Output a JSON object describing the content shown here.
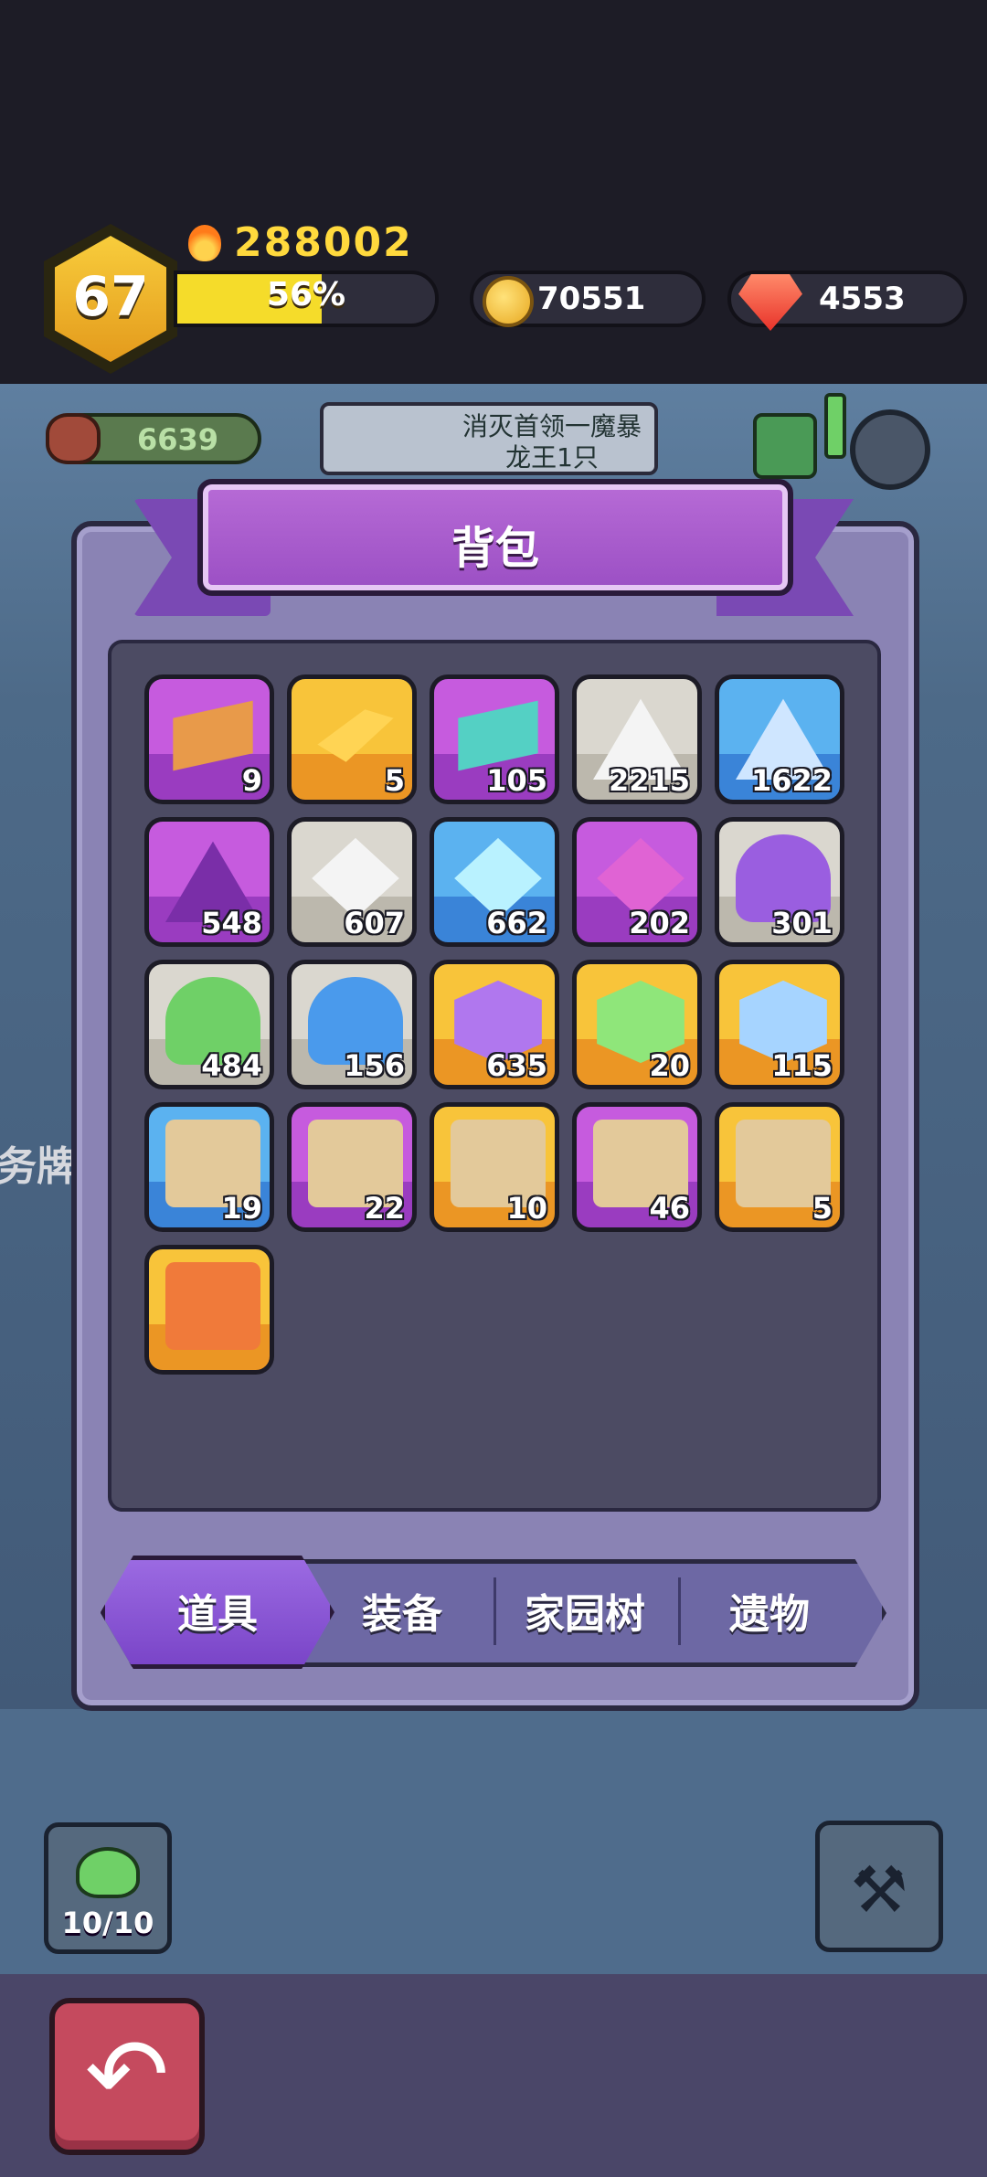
{
  "header": {
    "level": "67",
    "power": "288002",
    "xp_percent_label": "56%",
    "xp_fraction": 0.56,
    "coins": "70551",
    "gems": "4553"
  },
  "scene": {
    "meat": "6639",
    "quest_text": "消灭首领一魔暴龙王1只",
    "side_text": "务牌",
    "slime_count": "10/10"
  },
  "panel": {
    "title": "背包",
    "items": [
      {
        "icon": "purple-ticket-icon",
        "count": "9"
      },
      {
        "icon": "gold-bar-icon",
        "count": "5"
      },
      {
        "icon": "teal-ticket-icon",
        "count": "105"
      },
      {
        "icon": "grey-ore-icon",
        "count": "2215"
      },
      {
        "icon": "blue-ore-icon",
        "count": "1622"
      },
      {
        "icon": "purple-ore-icon",
        "count": "548"
      },
      {
        "icon": "grey-crystal-icon",
        "count": "607"
      },
      {
        "icon": "blue-crystal-icon",
        "count": "662"
      },
      {
        "icon": "purple-crystal-icon",
        "count": "202"
      },
      {
        "icon": "purple-slime-icon",
        "count": "301"
      },
      {
        "icon": "green-slime-icon",
        "count": "484"
      },
      {
        "icon": "blue-slime-icon",
        "count": "156"
      },
      {
        "icon": "purple-cube-icon",
        "count": "635"
      },
      {
        "icon": "green-cube-icon",
        "count": "20"
      },
      {
        "icon": "blue-cube-icon",
        "count": "115"
      },
      {
        "icon": "skull-map-blue-icon",
        "count": "19"
      },
      {
        "icon": "skull-map-purple-icon",
        "count": "22"
      },
      {
        "icon": "skull-map-gold-icon",
        "count": "10"
      },
      {
        "icon": "gold-map-purple-icon",
        "count": "46"
      },
      {
        "icon": "gold-map-gold-icon",
        "count": "5"
      },
      {
        "icon": "no-ads-card-icon",
        "count": ""
      }
    ]
  },
  "tabs": [
    "道具",
    "装备",
    "家园树",
    "遗物"
  ],
  "colors": {
    "accent_purple": "#9b4fc4",
    "panel": "#8a83b4",
    "grid": "#4c4b63",
    "back_button": "#c54a5e"
  }
}
